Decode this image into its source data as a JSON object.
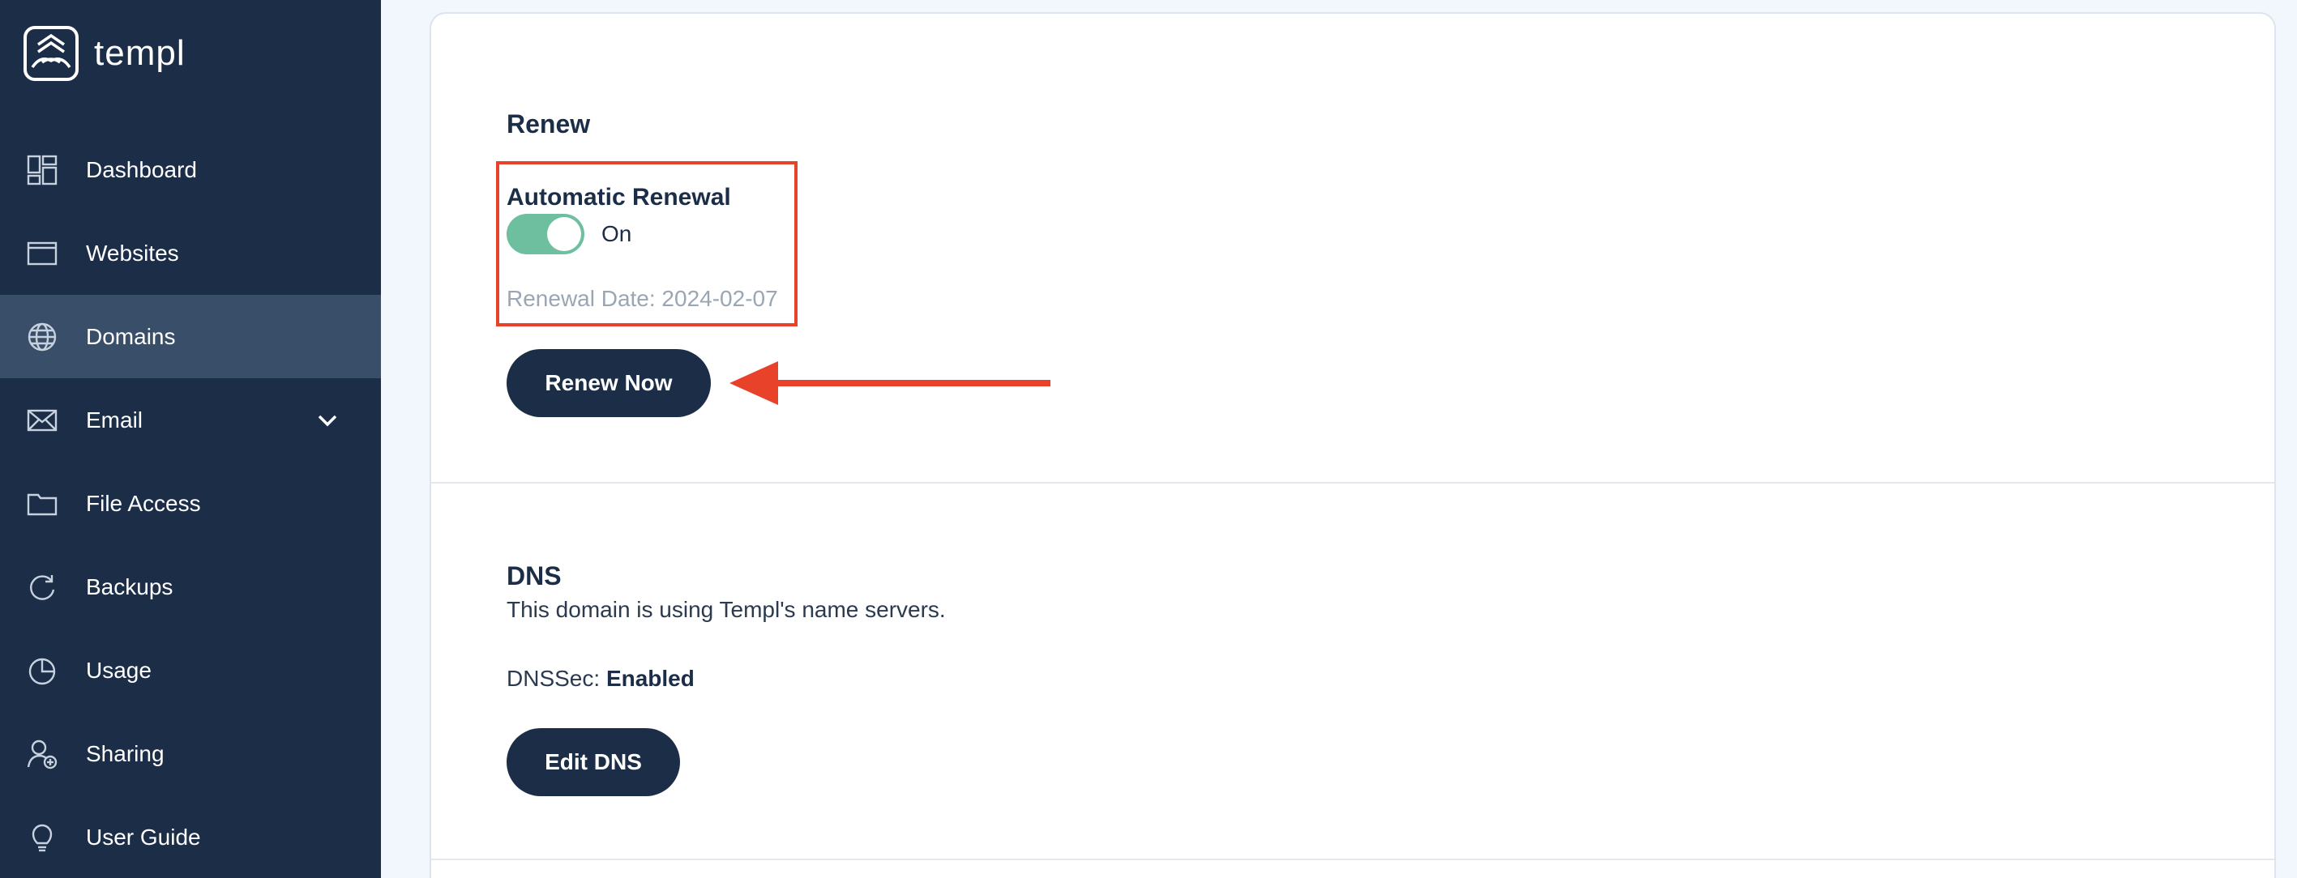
{
  "brand": {
    "name": "templ",
    "logo_icon": "templ-logo-icon"
  },
  "sidebar": {
    "items": [
      {
        "label": "Dashboard",
        "icon": "dashboard-icon"
      },
      {
        "label": "Websites",
        "icon": "browser-window-icon"
      },
      {
        "label": "Domains",
        "icon": "globe-icon",
        "active": true
      },
      {
        "label": "Email",
        "icon": "envelope-icon",
        "has_chevron": true
      },
      {
        "label": "File Access",
        "icon": "folder-icon"
      },
      {
        "label": "Backups",
        "icon": "refresh-icon"
      },
      {
        "label": "Usage",
        "icon": "pie-chart-icon"
      },
      {
        "label": "Sharing",
        "icon": "user-share-icon"
      },
      {
        "label": "User Guide",
        "icon": "lightbulb-icon"
      }
    ]
  },
  "renew": {
    "title": "Renew",
    "auto_renewal_title": "Automatic Renewal",
    "toggle_state": "On",
    "renewal_date": "Renewal Date: 2024-02-07",
    "renew_button": "Renew Now"
  },
  "dns": {
    "title": "DNS",
    "description": "This domain is using Templ's name servers.",
    "dnssec_label": "DNSSec: ",
    "dnssec_value": "Enabled",
    "edit_button": "Edit DNS"
  },
  "colors": {
    "sidebar_bg": "#1b2d47",
    "sidebar_active": "#384e69",
    "toggle_on": "#6dbf9f",
    "annotation_red": "#e8432a",
    "button_bg": "#1b2d47",
    "page_bg": "#f1f7fc"
  }
}
